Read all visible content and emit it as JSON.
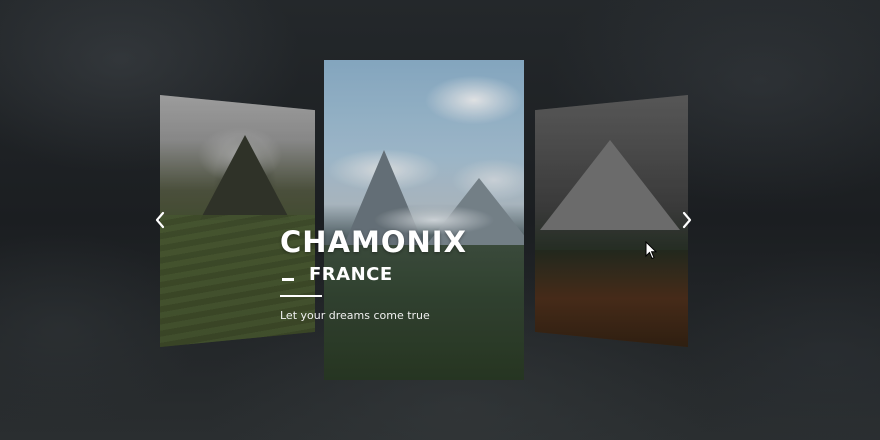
{
  "slider": {
    "active_slide": {
      "title": "CHAMONIX",
      "subtitle": "FRANCE",
      "tagline": "Let your dreams come true"
    }
  },
  "icons": {
    "prev": "chevron-left-icon",
    "next": "chevron-right-icon",
    "cursor": "mouse-pointer-icon"
  },
  "colors": {
    "background": "#1a1d20",
    "text": "#ffffff"
  }
}
